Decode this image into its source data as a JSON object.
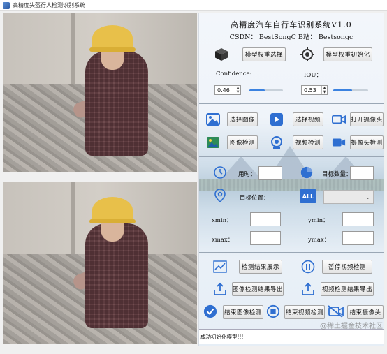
{
  "window": {
    "title": "高精度头盔行人检测识别系统"
  },
  "panel": {
    "heading": "高精度汽车自行车识别系统V1.0",
    "credits": "CSDN：  BestSongC   B站：  Bestsongc",
    "model_select_label": "模型权重选择",
    "model_init_label": "模型权重初始化",
    "confidence": {
      "label": "Confidence:",
      "value": "0.46",
      "level": 0.46
    },
    "iou": {
      "label": "IOU：",
      "value": "0.53",
      "level": 0.53
    },
    "select_image_label": "选择图像",
    "select_video_label": "选择视频",
    "open_camera_label": "打开摄像头",
    "image_detect_label": "图像检测",
    "video_detect_label": "视频检测",
    "camera_detect_label": "摄像头检测",
    "time_label": "用时：",
    "target_count_label": "目标数量：",
    "target_position_label": "目标位置：",
    "xmin_label": "xmin：",
    "ymin_label": "ymin：",
    "xmax_label": "xmax：",
    "ymax_label": "ymax：",
    "all_badge": "ALL",
    "show_results_label": "检测结果展示",
    "pause_video_label": "暂停视频检测",
    "export_image_label": "图像检测结果导出",
    "export_video_label": "视频检测结果导出",
    "end_image_label": "结束图像检测",
    "end_video_label": "结束视频检测",
    "end_camera_label": "结束摄像头",
    "status_text": "成功初始化模型!!!"
  },
  "watermark": "@稀土掘金技术社区",
  "colors": {
    "accent": "#3b82e0",
    "icon_blue": "#2f6fd1",
    "icon_dark": "#2b2b2b"
  }
}
